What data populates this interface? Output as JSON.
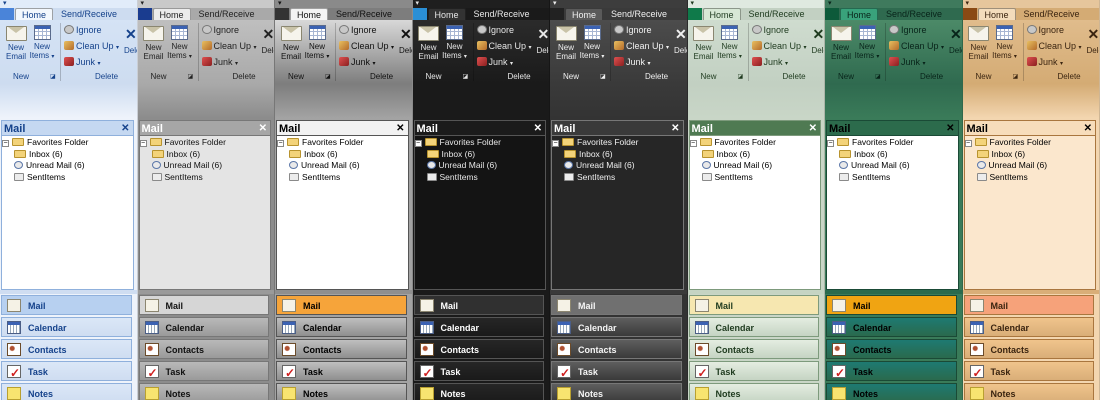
{
  "ribbon": {
    "quick_access": "▾",
    "tabs": {
      "home": "Home",
      "send_receive": "Send/Receive"
    },
    "new_email": {
      "line1": "New",
      "line2": "Email"
    },
    "new_items": {
      "line1": "New",
      "line2": "Items"
    },
    "dropdown_arrow": "▾",
    "ignore": "Ignore",
    "clean_up": "Clean Up",
    "junk": "Junk",
    "delete_glyph": "✕",
    "delete_truncated": "Dele",
    "group_new": "New",
    "group_delete": "Delete",
    "dialog_launcher": "◪"
  },
  "pane": {
    "title": "Mail",
    "close": "✕",
    "tree": {
      "expander": "−",
      "root": "Favorites Folder",
      "items": [
        "Inbox (6)",
        "Unread Mail (6)",
        "SentItems"
      ]
    }
  },
  "nav": {
    "items": [
      "Mail",
      "Calendar",
      "Contacts",
      "Task",
      "Notes"
    ],
    "icons": [
      "mail-icon",
      "calendar-icon",
      "contacts-icon",
      "task-icon",
      "notes-icon"
    ]
  },
  "themes": [
    {
      "name": "blue",
      "colors": {
        "top": "#e1ecfa",
        "ribbon": "#d5e3f5",
        "tabbar": "#cddcf0",
        "home_tab": "#f2f7fd",
        "appbtn": "#4a84d9",
        "text": "#15428b",
        "header_bg": "#c5d8f1",
        "header_text": "#15428b",
        "tree_bg": "#ffffff",
        "tree_text": "#000000",
        "nav_bg": "#cfddf1",
        "nav_btn": "#dbe7f7",
        "nav_active": "#b7d0f0",
        "nav_text": "#15428b",
        "body": "#eef3fb",
        "border": "#8fb0dc"
      }
    },
    {
      "name": "gray",
      "colors": {
        "top": "#c9c9c9",
        "ribbon": "#bfbfbf",
        "tabbar": "#a9a9a9",
        "home_tab": "#ebebeb",
        "appbtn": "#1a3c8f",
        "text": "#222222",
        "header_bg": "#a6a6a6",
        "header_text": "#ffffff",
        "tree_bg": "#e4e4e4",
        "tree_text": "#111111",
        "nav_bg": "#9a9a9a",
        "nav_btn": "#b9b9b9",
        "nav_active": "#d6d6d6",
        "nav_text": "#111111",
        "body": "#8c8c8c",
        "border": "#777777"
      }
    },
    {
      "name": "silver",
      "colors": {
        "top": "#8a8a8a",
        "ribbon": "#d8d8d8",
        "tabbar": "#7d7d7d",
        "home_tab": "#f4f4f4",
        "appbtn": "#333333",
        "text": "#111111",
        "header_bg": "#f2f2f2",
        "header_text": "#000000",
        "tree_bg": "#ffffff",
        "tree_text": "#000000",
        "nav_bg": "#8f8f8f",
        "nav_btn": "#bfbfbf",
        "nav_active": "#f6a43a",
        "nav_text": "#000000",
        "body": "#a3a3a3",
        "border": "#555555"
      }
    },
    {
      "name": "black",
      "colors": {
        "top": "#1f1f1f",
        "ribbon": "#2b2b2b",
        "tabbar": "#1a1a1a",
        "home_tab": "#333333",
        "appbtn": "#2a8fd6",
        "text": "#e6e6e6",
        "header_bg": "#1b1b1b",
        "header_text": "#ffffff",
        "tree_bg": "#141414",
        "tree_text": "#e6e6e6",
        "nav_bg": "#1a1a1a",
        "nav_btn": "#262626",
        "nav_active": "#303030",
        "nav_text": "#ffffff",
        "body": "#1a1a1a",
        "border": "#555555"
      }
    },
    {
      "name": "dark-gray",
      "colors": {
        "top": "#3d3d3d",
        "ribbon": "#4c4c4c",
        "tabbar": "#3a3a3a",
        "home_tab": "#5a5a5a",
        "appbtn": "#222222",
        "text": "#f0f0f0",
        "header_bg": "#3a3a3a",
        "header_text": "#ffffff",
        "tree_bg": "#262626",
        "tree_text": "#f0f0f0",
        "nav_bg": "#3a3a3a",
        "nav_btn": "#5e5e5e",
        "nav_active": "#707070",
        "nav_text": "#f5f5f5",
        "body": "#333333",
        "border": "#777777"
      }
    },
    {
      "name": "sage",
      "colors": {
        "top": "#dfe9e0",
        "ribbon": "#cfdccf",
        "tabbar": "#c2d0c2",
        "home_tab": "#d7e8d5",
        "appbtn": "#0f7a4a",
        "text": "#1e3a1e",
        "header_bg": "#4f7a52",
        "header_text": "#ffffff",
        "tree_bg": "#ffffff",
        "tree_text": "#000000",
        "nav_bg": "#c5d4c3",
        "nav_btn": "#e4ede1",
        "nav_active": "#f6e7b0",
        "nav_text": "#1e3a1e",
        "body": "#c9d6c7",
        "border": "#7d9a7c"
      }
    },
    {
      "name": "teal",
      "colors": {
        "top": "#3f7a5d",
        "ribbon": "#4c8a68",
        "tabbar": "#2f6a4f",
        "home_tab": "#39a27b",
        "appbtn": "#0d5a3a",
        "text": "#08241a",
        "header_bg": "#2c6b4c",
        "header_text": "#000000",
        "tree_bg": "#ffffff",
        "tree_text": "#000000",
        "nav_bg": "#2a6a4d",
        "nav_btn": "#1e7a72",
        "nav_active": "#f0a412",
        "nav_text": "#000000",
        "body": "#3a7b59",
        "border": "#1a4a36"
      }
    },
    {
      "name": "tan",
      "colors": {
        "top": "#e6c69c",
        "ribbon": "#e0bc8c",
        "tabbar": "#d4ab74",
        "home_tab": "#f3dcbc",
        "appbtn": "#8a4a14",
        "text": "#3a2410",
        "header_bg": "#f7ddbb",
        "header_text": "#000000",
        "tree_bg": "#fbe7cd",
        "tree_text": "#000000",
        "nav_bg": "#d9ae78",
        "nav_btn": "#f0c48c",
        "nav_active": "#f6a27a",
        "nav_text": "#3a2410",
        "body": "#f3d6b0",
        "border": "#a9763e"
      }
    }
  ]
}
